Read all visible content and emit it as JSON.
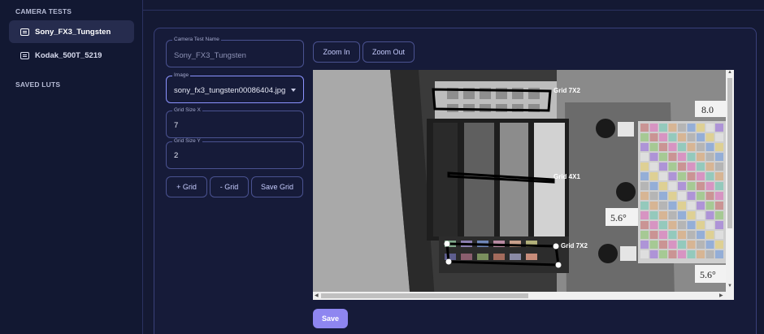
{
  "sidebar": {
    "camera_tests_title": "CAMERA TESTS",
    "items": [
      {
        "label": "Sony_FX3_Tungsten",
        "active": true
      },
      {
        "label": "Kodak_500T_5219",
        "active": false
      }
    ],
    "saved_luts_title": "SAVED LUTS"
  },
  "form": {
    "camera_test_name": {
      "label": "Camera Test Name",
      "value": "Sony_FX3_Tungsten"
    },
    "image": {
      "label": "Image",
      "value": "sony_fx3_tungsten00086404.jpg"
    },
    "grid_size_x": {
      "label": "Grid Size X",
      "value": "7"
    },
    "grid_size_y": {
      "label": "Grid Size Y",
      "value": "2"
    }
  },
  "buttons": {
    "add_grid": "+ Grid",
    "remove_grid": "- Grid",
    "save_grid": "Save Grid",
    "zoom_in": "Zoom In",
    "zoom_out": "Zoom Out",
    "save": "Save"
  },
  "image_overlay": {
    "grid_labels": [
      "Grid 7X2",
      "Grid 4X1",
      "Grid 7X2"
    ],
    "handwritten": [
      "8.0",
      "5.6°",
      "5.6°"
    ]
  },
  "colors": {
    "accent": "#8e86f0",
    "border": "#4a5290",
    "background": "#141933"
  }
}
